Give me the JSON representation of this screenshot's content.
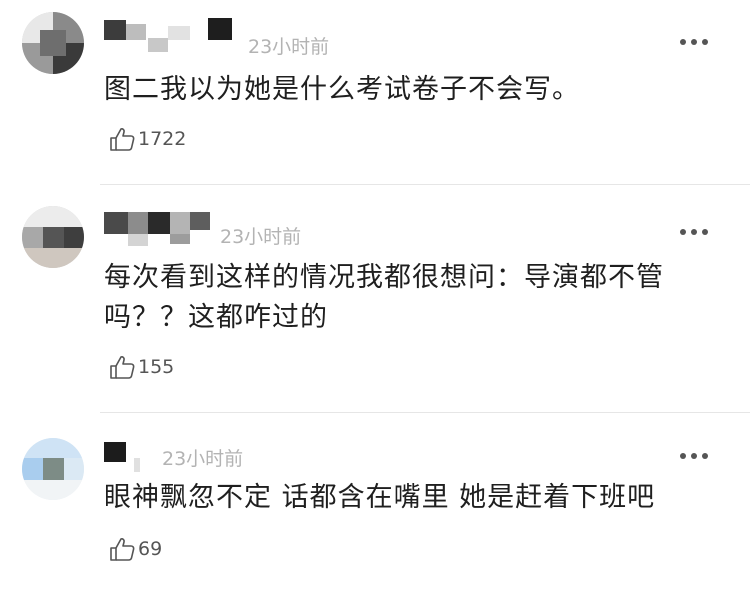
{
  "comments": [
    {
      "time": "23小时前",
      "text": "图二我以为她是什么考试卷子不会写。",
      "likes": "1722"
    },
    {
      "time": "23小时前",
      "text": "每次看到这样的情况我都很想问：导演都不管吗？？这都咋过的",
      "likes": "155"
    },
    {
      "time": "23小时前",
      "text": "眼神飘忽不定 话都含在嘴里 她是赶着下班吧",
      "likes": "69"
    }
  ],
  "icons": {
    "like": "thumbs-up-icon",
    "more": "more-options-icon"
  },
  "colors": {
    "text": "#1f1f1f",
    "meta": "#b3b3b3",
    "divider": "#e6e6e6"
  }
}
